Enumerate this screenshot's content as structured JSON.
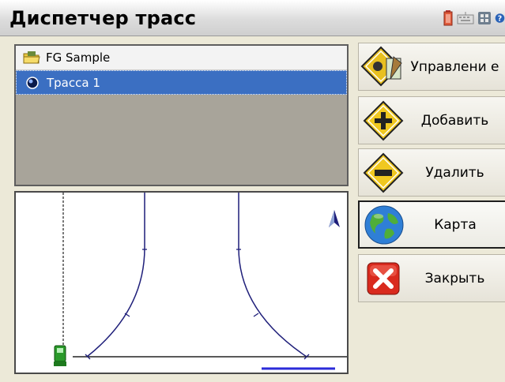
{
  "window": {
    "title": "Диспетчер трасс",
    "tray_icons": [
      "battery-icon",
      "keyboard-icon",
      "network-icon",
      "help-icon"
    ]
  },
  "tree": {
    "items": [
      {
        "label": "FG Sample",
        "icon": "folder-icon",
        "selected": false
      },
      {
        "label": "Трасса 1",
        "icon": "road-icon",
        "selected": true
      }
    ]
  },
  "map": {
    "north_arrow": "north-arrow-icon",
    "instrument_icon": "total-station-icon",
    "scale_bar_color": "#2b2bd9",
    "line_color": "#1f1f7a"
  },
  "buttons": {
    "manage": {
      "label": "Управлени е",
      "icon": "manage-icon"
    },
    "add": {
      "label": "Добавить",
      "icon": "add-sign-icon"
    },
    "delete": {
      "label": "Удалить",
      "icon": "delete-sign-icon"
    },
    "map": {
      "label": "Карта",
      "icon": "globe-icon"
    },
    "close": {
      "label": "Закрыть",
      "icon": "close-icon"
    }
  },
  "colors": {
    "selection": "#3b6fc2",
    "background": "#ece9d8"
  }
}
